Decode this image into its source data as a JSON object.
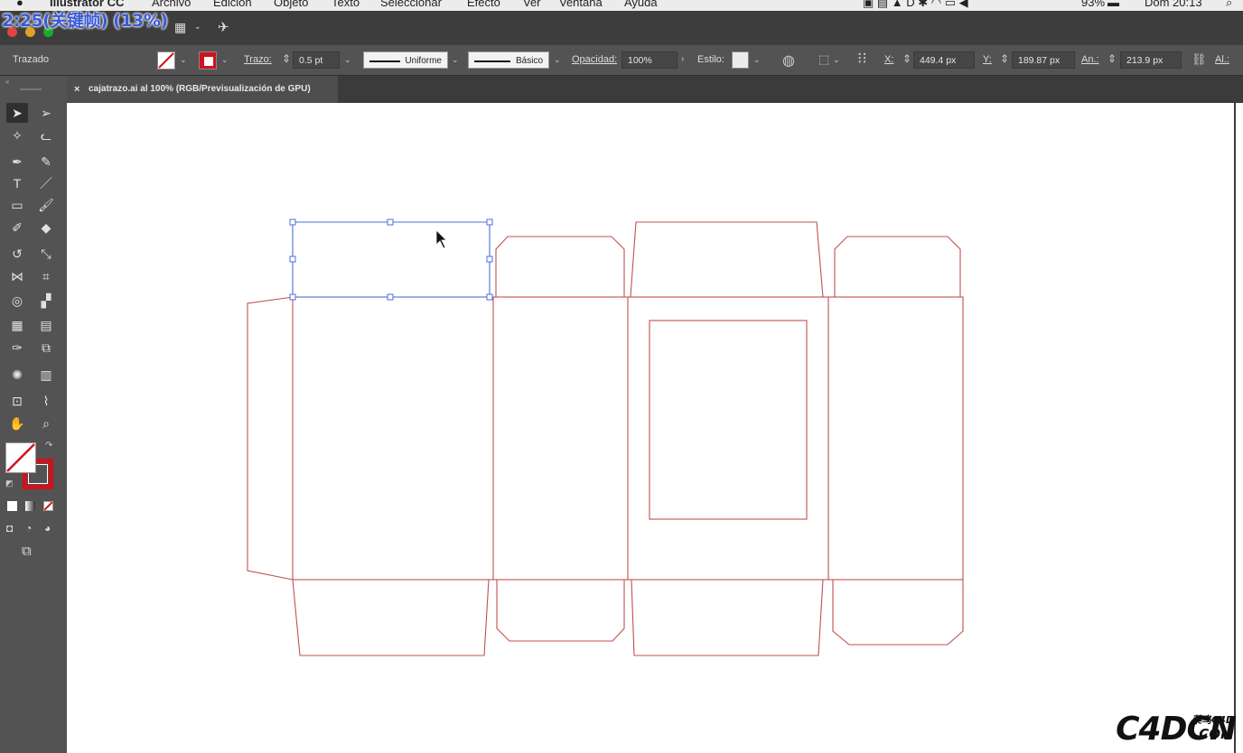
{
  "menubar": {
    "app": "Illustrator CC",
    "items": [
      "Archivo",
      "Edición",
      "Objeto",
      "Texto",
      "Seleccionar",
      "Efecto",
      "Ver",
      "Ventana",
      "Ayuda"
    ],
    "battery": "93%",
    "clock": "Dom 20:13"
  },
  "overlay_timestamp": "2:25(关键帧) (13%)",
  "control_bar": {
    "object_type": "Trazado",
    "stroke_label": "Trazo:",
    "stroke_value": "0.5 pt",
    "profile": "Uniforme",
    "brush": "Básico",
    "opacity_label": "Opacidad:",
    "opacity_value": "100%",
    "style_label": "Estilo:",
    "x_label": "X:",
    "x_value": "449.4 px",
    "y_label": "Y:",
    "y_value": "189.87 px",
    "w_label": "An.:",
    "w_value": "213.9 px",
    "h_label": "Al.:"
  },
  "document_tab": {
    "close": "×",
    "title": "cajatrazo.ai al 100% (RGB/Previsualización de GPU)"
  },
  "colors": {
    "dieline": "#c0504f",
    "selection": "#4a6fd8",
    "stroke_swatch": "#d0121b"
  },
  "tools": [
    "selection-tool",
    "direct-selection-tool",
    "magic-wand-tool",
    "lasso-tool",
    "pen-tool",
    "curvature-tool",
    "type-tool",
    "line-tool",
    "rectangle-tool",
    "paintbrush-tool",
    "shaper-tool",
    "eraser-tool",
    "rotate-tool",
    "scale-tool",
    "width-tool",
    "free-transform-tool",
    "shape-builder-tool",
    "perspective-grid-tool",
    "mesh-tool",
    "gradient-tool",
    "eyedropper-tool",
    "blend-tool",
    "symbol-sprayer-tool",
    "column-graph-tool",
    "artboard-tool",
    "slice-tool",
    "hand-tool",
    "zoom-tool"
  ],
  "watermark": {
    "main": "C4DCN",
    "cn": "菜鸟C4D",
    "com": ".COM"
  }
}
